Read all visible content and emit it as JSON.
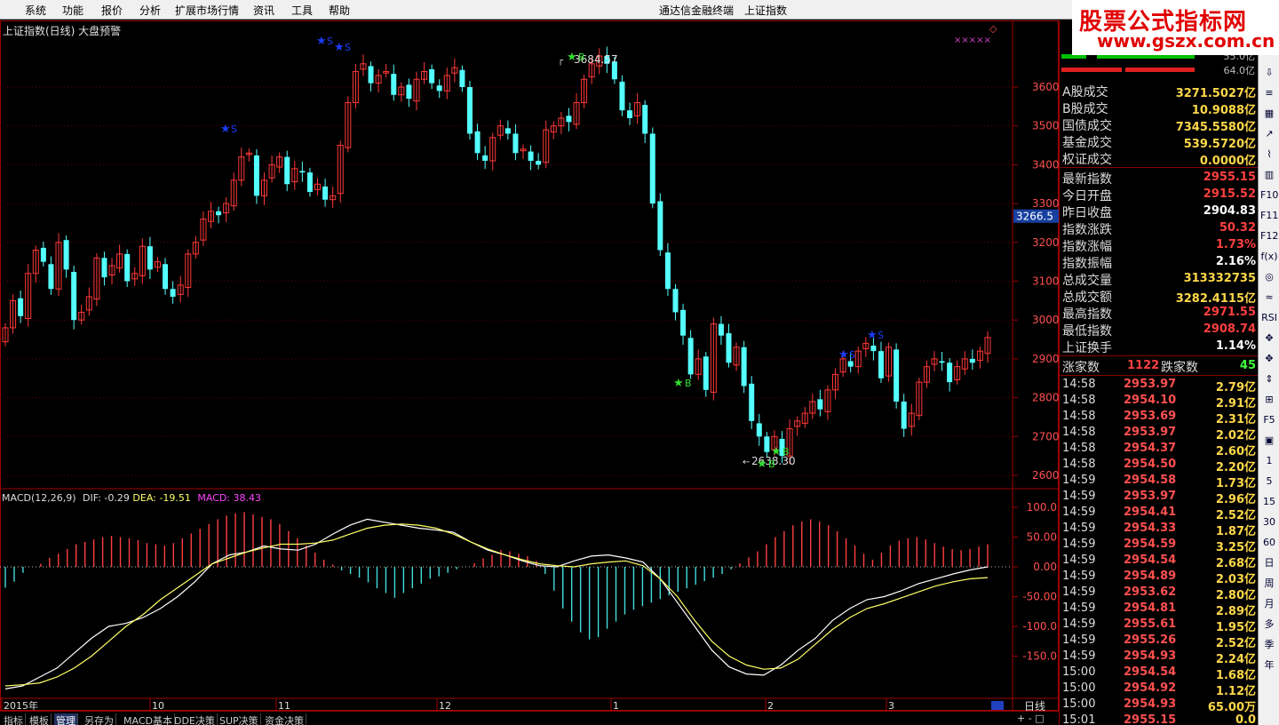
{
  "menu": [
    "系统",
    "功能",
    "报价",
    "分析",
    "扩展市场行情",
    "资讯",
    "工具",
    "帮助"
  ],
  "app_title": "通达信金融终端　上证指数",
  "watermark": {
    "title": "股票公式指标网",
    "url": "www.gszx.com.cn"
  },
  "chart": {
    "label": "上证指数(日线) 大盘预警",
    "price_ticks": [
      "3600",
      "3500",
      "3400",
      "3300",
      "3200",
      "3100",
      "3000",
      "2900",
      "2800",
      "2700",
      "2600"
    ],
    "current_price_tag": "3266.5",
    "high_marker": "3684.57",
    "low_marker": "2638.30",
    "signal_buy": "B",
    "signal_sell": "S",
    "macd_label": "MACD(12,26,9)",
    "macd_dif": "DIF: -0.29",
    "macd_dea": "DEA: -19.51",
    "macd_val": "MACD: 38.43",
    "macd_ticks": [
      "100.0",
      "50.00",
      "0.00",
      "-50.00",
      "-100.0",
      "-150.0"
    ],
    "date_labels": [
      "2015年",
      "10",
      "11",
      "12",
      "1",
      "2",
      "3"
    ],
    "period": "日线"
  },
  "tabs": [
    "指标",
    "模板",
    "管理",
    "另存为",
    "MACD基本",
    "DDE决策",
    "SUP决策",
    "资金决策"
  ],
  "tab_active": "管理",
  "panel": {
    "top_values": [
      "55.0亿",
      "64.0亿"
    ],
    "turnover": [
      {
        "label": "A股成交",
        "value": "3271.5027亿"
      },
      {
        "label": "B股成交",
        "value": "10.9088亿"
      },
      {
        "label": "国债成交",
        "value": "7345.5580亿"
      },
      {
        "label": "基金成交",
        "value": "539.5720亿"
      },
      {
        "label": "权证成交",
        "value": "0.0000亿"
      }
    ],
    "index_info": [
      {
        "label": "最新指数",
        "value": "2955.15",
        "color": "#ff4040"
      },
      {
        "label": "今日开盘",
        "value": "2915.52",
        "color": "#ff4040"
      },
      {
        "label": "昨日收盘",
        "value": "2904.83",
        "color": "#ffffff"
      },
      {
        "label": "指数涨跌",
        "value": "50.32",
        "color": "#ff4040"
      },
      {
        "label": "指数涨幅",
        "value": "1.73%",
        "color": "#ff4040"
      },
      {
        "label": "指数振幅",
        "value": "2.16%",
        "color": "#ffffff"
      },
      {
        "label": "总成交量",
        "value": "313332735",
        "color": "#ffd84a"
      },
      {
        "label": "总成交额",
        "value": "3282.4115亿",
        "color": "#ffd84a"
      },
      {
        "label": "最高指数",
        "value": "2971.55",
        "color": "#ff4040"
      },
      {
        "label": "最低指数",
        "value": "2908.74",
        "color": "#ff4040"
      },
      {
        "label": "上证换手",
        "value": "1.14%",
        "color": "#ffffff"
      }
    ],
    "rise_label": "涨家数",
    "rise_count": "1122",
    "fall_label": "跌家数",
    "fall_count": "45",
    "ticks": [
      {
        "time": "14:58",
        "price": "2953.97",
        "vol": "2.79亿"
      },
      {
        "time": "14:58",
        "price": "2954.10",
        "vol": "2.91亿"
      },
      {
        "time": "14:58",
        "price": "2953.69",
        "vol": "2.31亿"
      },
      {
        "time": "14:58",
        "price": "2953.97",
        "vol": "2.02亿"
      },
      {
        "time": "14:58",
        "price": "2954.37",
        "vol": "2.60亿"
      },
      {
        "time": "14:58",
        "price": "2954.50",
        "vol": "2.20亿"
      },
      {
        "time": "14:59",
        "price": "2954.58",
        "vol": "1.73亿"
      },
      {
        "time": "14:59",
        "price": "2953.97",
        "vol": "2.96亿"
      },
      {
        "time": "14:59",
        "price": "2954.41",
        "vol": "2.52亿"
      },
      {
        "time": "14:59",
        "price": "2954.33",
        "vol": "1.87亿"
      },
      {
        "time": "14:59",
        "price": "2954.59",
        "vol": "3.25亿"
      },
      {
        "time": "14:59",
        "price": "2954.54",
        "vol": "2.68亿"
      },
      {
        "time": "14:59",
        "price": "2954.89",
        "vol": "2.03亿"
      },
      {
        "time": "14:59",
        "price": "2953.62",
        "vol": "2.80亿"
      },
      {
        "time": "14:59",
        "price": "2954.81",
        "vol": "2.89亿"
      },
      {
        "time": "14:59",
        "price": "2955.61",
        "vol": "1.95亿"
      },
      {
        "time": "14:59",
        "price": "2955.26",
        "vol": "2.52亿"
      },
      {
        "time": "14:59",
        "price": "2954.93",
        "vol": "2.24亿"
      },
      {
        "time": "15:00",
        "price": "2954.54",
        "vol": "1.68亿"
      },
      {
        "time": "15:00",
        "price": "2954.92",
        "vol": "1.12亿"
      },
      {
        "time": "15:00",
        "price": "2954.93",
        "vol": "65.00万"
      },
      {
        "time": "15:01",
        "price": "2955.15",
        "vol": "0.0"
      }
    ]
  },
  "toolbar": [
    "G",
    "⇧",
    "⇩",
    "≡",
    "▦",
    "↗",
    "⌇",
    "▥",
    "F10",
    "F11",
    "F12",
    "f(x)",
    "◎",
    "≈",
    "RSI",
    "✥",
    "✥",
    "⇕",
    "⊞",
    "F5",
    "▣",
    "1",
    "5",
    "15",
    "30",
    "60",
    "日",
    "周",
    "月",
    "多",
    "季",
    "年"
  ],
  "colors": {
    "up": "#ff3838",
    "down": "#54ffff",
    "axis": "#a00000",
    "grid": "#600000"
  }
}
